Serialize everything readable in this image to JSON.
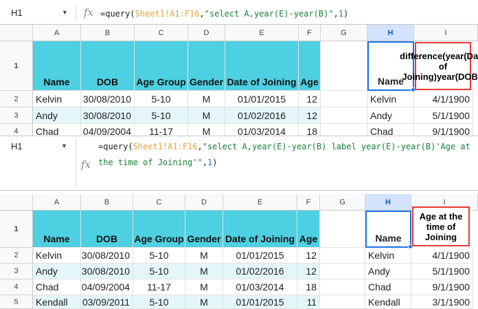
{
  "top": {
    "name_box": "H1",
    "formula_parts": [
      "=query(",
      "Sheet1!A1:F16",
      ",",
      "\"select A,year(E)-year(B)\"",
      ",",
      "1",
      ")"
    ],
    "columns": [
      "A",
      "B",
      "C",
      "D",
      "E",
      "F",
      "G",
      "H",
      "I"
    ],
    "rows": [
      "1",
      "2",
      "3",
      "4"
    ],
    "headers": [
      "Name",
      "DOB",
      "Age Group",
      "Gender",
      "Date of Joining",
      "Age"
    ],
    "data": [
      [
        "Kelvin",
        "30/08/2010",
        "5-10",
        "M",
        "01/01/2015",
        "12"
      ],
      [
        "Andy",
        "30/08/2010",
        "5-10",
        "M",
        "01/02/2016",
        "12"
      ],
      [
        "Chad",
        "04/09/2004",
        "11-17",
        "M",
        "01/03/2014",
        "18"
      ]
    ],
    "query_header_h": "Name",
    "query_header_i": "difference(year(Date of Joining)year(DOB))",
    "query_results": [
      [
        "Kelvin",
        "4/1/1900"
      ],
      [
        "Andy",
        "5/1/1900"
      ],
      [
        "Chad",
        "9/1/1900"
      ]
    ]
  },
  "bottom": {
    "name_box": "H1",
    "formula_line1_parts": [
      "=query(",
      "Sheet1!A1:F16",
      ",",
      "\"select A,year(E)-year(B) label year(E)-year(B)'Age at"
    ],
    "formula_line2_parts": [
      "the time of Joining'\"",
      ",",
      "1",
      ")"
    ],
    "columns": [
      "A",
      "B",
      "C",
      "D",
      "E",
      "F",
      "G",
      "H",
      "I"
    ],
    "rows": [
      "1",
      "2",
      "3",
      "4",
      "5"
    ],
    "headers": [
      "Name",
      "DOB",
      "Age Group",
      "Gender",
      "Date of Joining",
      "Age"
    ],
    "data": [
      [
        "Kelvin",
        "30/08/2010",
        "5-10",
        "M",
        "01/01/2015",
        "12"
      ],
      [
        "Andy",
        "30/08/2010",
        "5-10",
        "M",
        "01/02/2016",
        "12"
      ],
      [
        "Chad",
        "04/09/2004",
        "11-17",
        "M",
        "01/03/2014",
        "18"
      ],
      [
        "Kendall",
        "03/09/2011",
        "5-10",
        "M",
        "01/01/2015",
        "11"
      ]
    ],
    "query_header_h": "Name",
    "query_header_i": "Age at the time of Joining",
    "query_results": [
      [
        "Kelvin",
        "4/1/1900"
      ],
      [
        "Andy",
        "5/1/1900"
      ],
      [
        "Chad",
        "9/1/1900"
      ],
      [
        "Kendall",
        "3/1/1900"
      ]
    ]
  },
  "colors": {
    "header_fill": "#4dd0e1",
    "stripe_fill": "#e4f6f8",
    "highlight_border": "#e53935",
    "selection": "#1a73e8"
  }
}
